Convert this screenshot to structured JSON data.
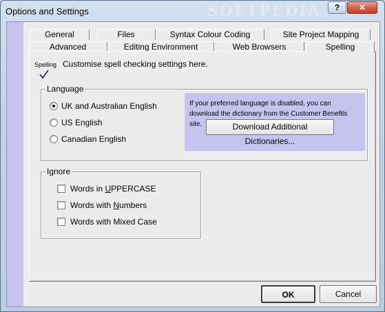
{
  "window": {
    "title": "Options and Settings",
    "watermark": "SOFTPEDIA",
    "help_label": "?",
    "close_label": "✕"
  },
  "tabs": {
    "row_top": [
      "General",
      "Files",
      "Syntax Colour Coding",
      "Site Project Mapping"
    ],
    "row_bottom": [
      "Advanced",
      "Editing Environment",
      "Web Browsers",
      "Spelling"
    ],
    "selected": "Spelling"
  },
  "page": {
    "tag": "Spelling",
    "description": "Customise spell checking settings here.",
    "icon": "checkmark-icon"
  },
  "language": {
    "label": "Language",
    "options": [
      {
        "label": "UK and Australian English",
        "selected": true
      },
      {
        "label": "US English",
        "selected": false
      },
      {
        "label": "Canadian English",
        "selected": false
      }
    ],
    "info": "If your preferred language is disabled, you can download the dictionary from the Customer Benefits site.",
    "download_button": "Download Additional Dictionaries..."
  },
  "ignore": {
    "label": "Ignore",
    "options": [
      {
        "prefix": "Words in ",
        "accel": "U",
        "suffix": "PPERCASE",
        "checked": false
      },
      {
        "prefix": "Words with ",
        "accel": "N",
        "suffix": "umbers",
        "checked": false
      },
      {
        "prefix": "Words with Mixed Case",
        "accel": "",
        "suffix": "",
        "checked": false
      }
    ]
  },
  "footer": {
    "ok": "OK",
    "cancel": "Cancel"
  },
  "colors": {
    "accent_strip": "#c7c3ef",
    "dialog_bg": "#ececec"
  }
}
